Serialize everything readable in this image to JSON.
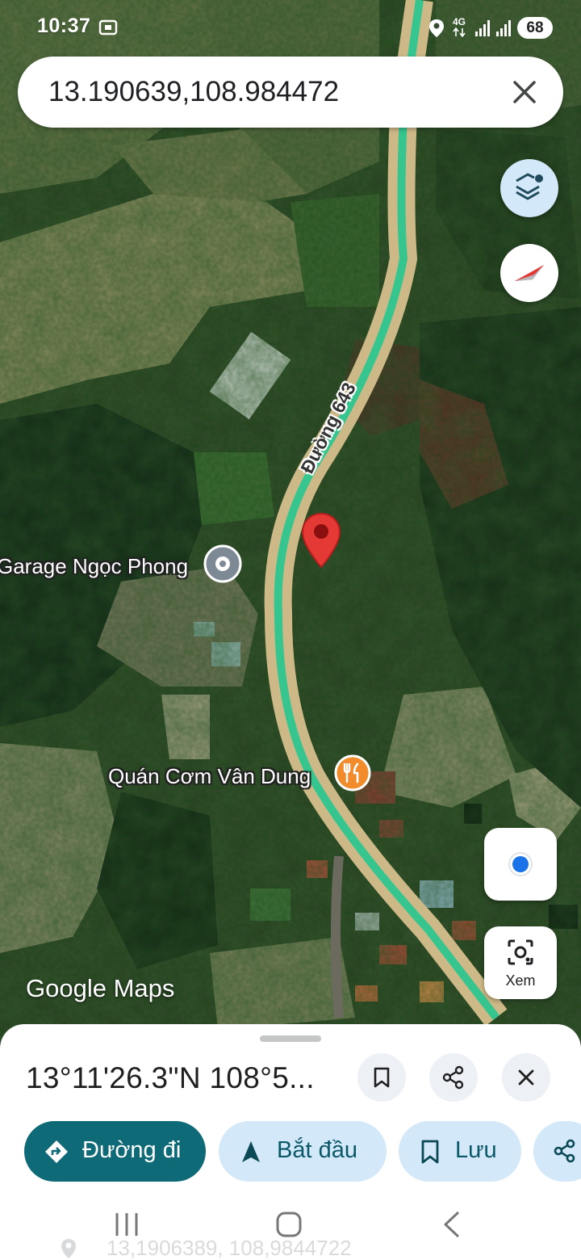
{
  "status_bar": {
    "time": "10:37",
    "network": "4G",
    "battery": "68"
  },
  "search": {
    "query": "13.190639,108.984472"
  },
  "map": {
    "road_name": "Đường 643",
    "places": [
      {
        "name": "Garage Ngọc Phong",
        "icon": "garage-pin-icon"
      },
      {
        "name": "Quán Cơm Vân Dung",
        "icon": "restaurant-icon"
      }
    ],
    "watermark": "Google Maps",
    "pin_color": "#e53935",
    "route_color": "#36c58f"
  },
  "controls": {
    "lens_label": "Xem"
  },
  "sheet": {
    "title": "13°11'26.3\"N 108°5..."
  },
  "actions": [
    {
      "label": "Đường đi",
      "icon": "directions-icon"
    },
    {
      "label": "Bắt đầu",
      "icon": "navigation-arrow-icon"
    },
    {
      "label": "Lưu",
      "icon": "bookmark-icon"
    }
  ],
  "background_hint": "13,1906389, 108,9844722"
}
